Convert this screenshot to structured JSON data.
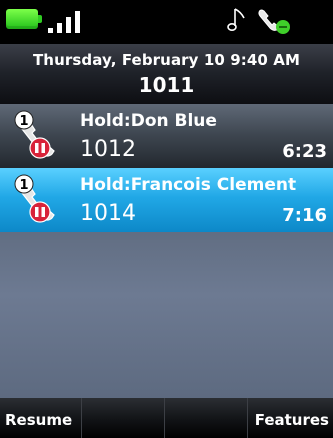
{
  "status_bar": {
    "battery_icon": "battery-full-icon",
    "signal_icon": "signal-bars-icon",
    "ringtone_icon": "music-note-icon",
    "handset_icon": "handset-status-icon",
    "colors": {
      "battery": "#2fcc22",
      "handset_accent": "#3fcf2a"
    }
  },
  "header": {
    "datetime": "Thursday, February 10 9:40 AM",
    "line": "1011"
  },
  "calls": [
    {
      "title": "Hold:Don Blue",
      "number": "1012",
      "timer": "6:23",
      "badge": "1",
      "icon": "call-on-hold-icon",
      "selected": false
    },
    {
      "title": "Hold:Francois Clement",
      "number": "1014",
      "timer": "7:16",
      "badge": "1",
      "icon": "call-on-hold-icon",
      "selected": true
    }
  ],
  "softkeys": [
    "Resume",
    "",
    "",
    "Features"
  ],
  "colors": {
    "selected_row": "#1f9fe0",
    "hold_indicator": "#d8233a"
  }
}
